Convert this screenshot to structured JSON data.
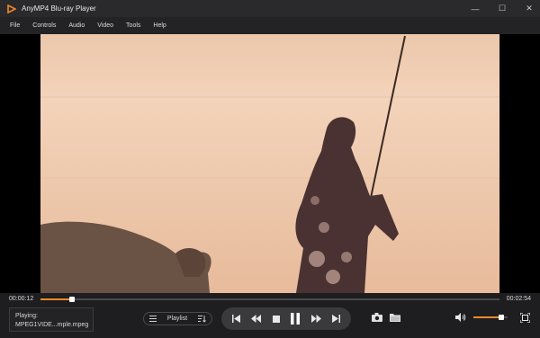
{
  "app": {
    "title": "AnyMP4 Blu-ray Player",
    "accent_color": "#f08a2a"
  },
  "window_controls": {
    "minimize": "—",
    "maximize": "☐",
    "close": "✕"
  },
  "menu": {
    "items": [
      "File",
      "Controls",
      "Audio",
      "Video",
      "Tools",
      "Help"
    ]
  },
  "playback": {
    "current_time": "00:00:12",
    "total_time": "00:02:54",
    "progress_fraction": 0.069,
    "volume_fraction": 0.82
  },
  "now_playing": {
    "label": "Playing:",
    "file": "MPEG1VIDE...mple.mpeg"
  },
  "playlist": {
    "label": "Playlist"
  },
  "icons": {
    "list": "list-icon",
    "sort": "sort-icon",
    "prev": "skip-back-icon",
    "rewind": "rewind-icon",
    "stop": "stop-icon",
    "pause": "pause-icon",
    "forward": "fast-forward-icon",
    "next": "skip-forward-icon",
    "snapshot": "camera-icon",
    "folder": "folder-icon",
    "volume": "volume-icon",
    "fullscreen": "fullscreen-icon"
  }
}
